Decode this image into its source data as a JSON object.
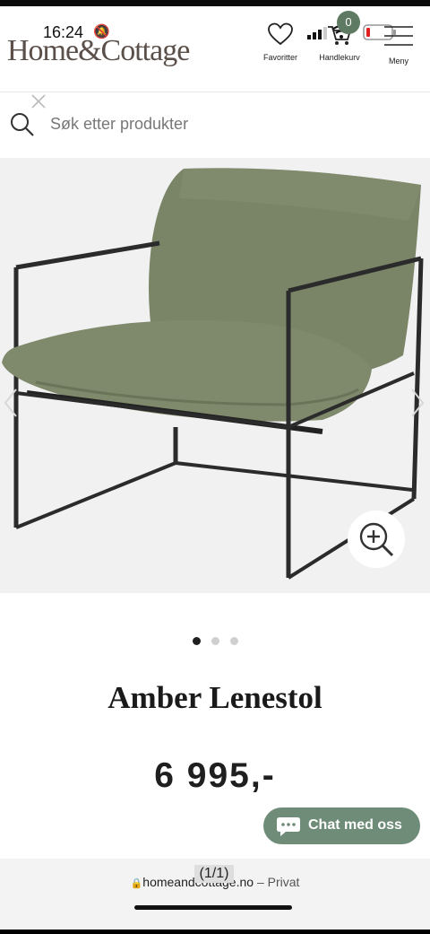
{
  "status": {
    "time": "16:24"
  },
  "header": {
    "logo": "Home&Cottage",
    "nav": [
      {
        "label": "Favoritter"
      },
      {
        "label": "Handlekurv",
        "badge": "0"
      },
      {
        "label": "Meny"
      }
    ]
  },
  "search": {
    "placeholder": "Søk etter produkter"
  },
  "product": {
    "title": "Amber Lenestol",
    "price": "6 995,-",
    "image_count": 3,
    "active_image_index": 0
  },
  "chat": {
    "label": "Chat med oss"
  },
  "browser": {
    "domain": "homeandcottage.no",
    "separator": "–",
    "mode": "Privat",
    "tab_counter": "(1/1)"
  },
  "colors": {
    "cushion": "#7a8467",
    "frame": "#2b2b2b",
    "chat_button": "#6f8c78",
    "logo_text": "#5a4f49"
  }
}
